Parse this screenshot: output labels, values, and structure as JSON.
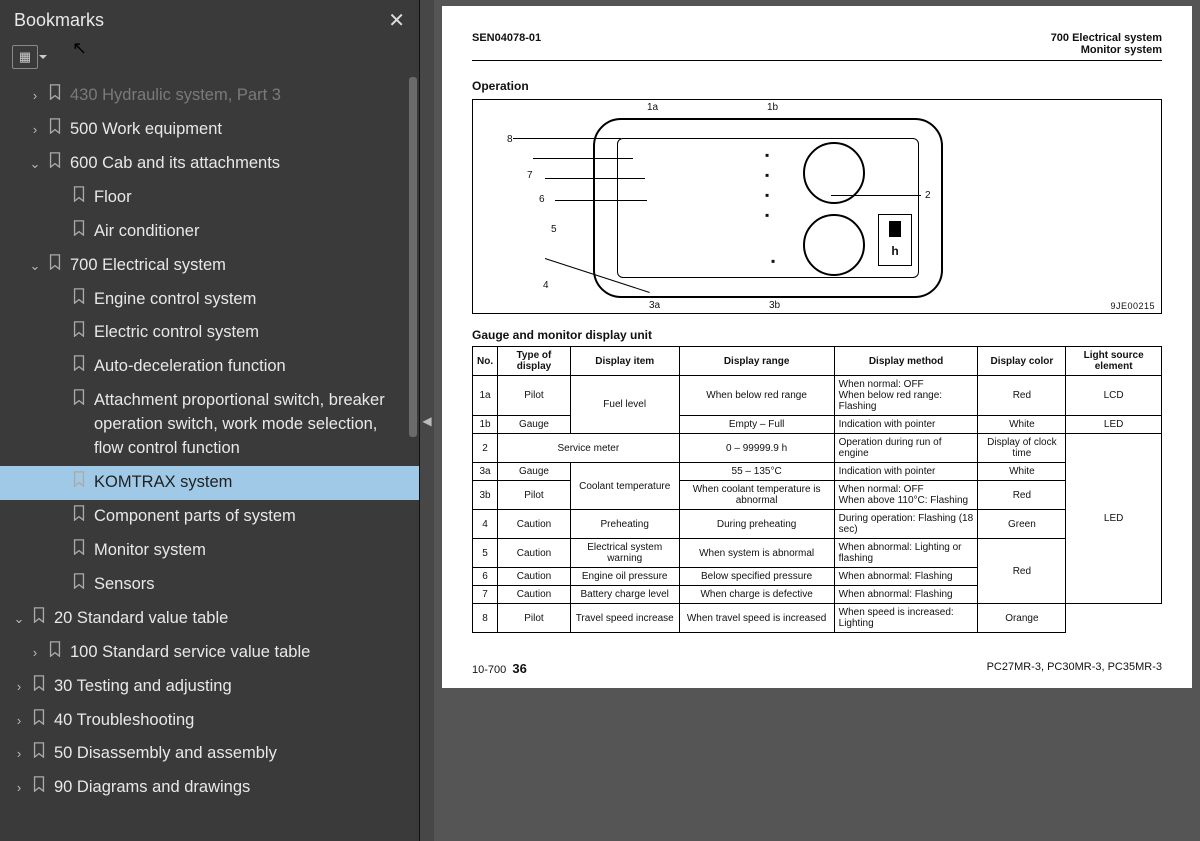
{
  "sidebar": {
    "title": "Bookmarks",
    "items": [
      {
        "indent": 1,
        "arrow": "›",
        "label": "430 Hydraulic system, Part 3",
        "cutoff": true
      },
      {
        "indent": 1,
        "arrow": "›",
        "label": "500 Work equipment"
      },
      {
        "indent": 1,
        "arrow": "⌄",
        "label": "600 Cab and its attachments"
      },
      {
        "indent": 2,
        "arrow": "",
        "label": "Floor"
      },
      {
        "indent": 2,
        "arrow": "",
        "label": "Air conditioner"
      },
      {
        "indent": 1,
        "arrow": "⌄",
        "label": "700 Electrical system"
      },
      {
        "indent": 2,
        "arrow": "",
        "label": "Engine control system"
      },
      {
        "indent": 2,
        "arrow": "",
        "label": "Electric control system"
      },
      {
        "indent": 2,
        "arrow": "",
        "label": "Auto-deceleration function"
      },
      {
        "indent": 2,
        "arrow": "",
        "label": "Attachment proportional switch, breaker operation switch, work mode selection, flow control function"
      },
      {
        "indent": 2,
        "arrow": "",
        "label": "KOMTRAX system",
        "selected": true
      },
      {
        "indent": 2,
        "arrow": "",
        "label": "Component parts of system"
      },
      {
        "indent": 2,
        "arrow": "",
        "label": "Monitor system"
      },
      {
        "indent": 2,
        "arrow": "",
        "label": "Sensors"
      },
      {
        "indent": 0,
        "arrow": "⌄",
        "label": "20 Standard value table"
      },
      {
        "indent": 1,
        "arrow": "›",
        "label": "100 Standard service value table"
      },
      {
        "indent": 0,
        "arrow": "›",
        "label": "30 Testing and adjusting"
      },
      {
        "indent": 0,
        "arrow": "›",
        "label": "40 Troubleshooting"
      },
      {
        "indent": 0,
        "arrow": "›",
        "label": "50 Disassembly and assembly"
      },
      {
        "indent": 0,
        "arrow": "›",
        "label": "90 Diagrams and drawings"
      }
    ]
  },
  "doc": {
    "code": "SEN04078-01",
    "chapter": "700 Electrical system",
    "subchapter": "Monitor system",
    "section": "Operation",
    "diagram_code": "9JE00215",
    "diagram_labels": [
      "1a",
      "1b",
      "2",
      "3a",
      "3b",
      "4",
      "5",
      "6",
      "7",
      "8"
    ],
    "table_title": "Gauge and monitor display unit",
    "headers": [
      "No.",
      "Type of display",
      "Display item",
      "Display range",
      "Display method",
      "Display color",
      "Light source element"
    ],
    "rows": [
      {
        "no": "1a",
        "type": "Pilot",
        "item": "Fuel level",
        "range": "When below red range",
        "method": "When normal: OFF\nWhen below red range: Flashing",
        "color": "Red",
        "src": "LCD",
        "item_rowspan": 2
      },
      {
        "no": "1b",
        "type": "Gauge",
        "item": "",
        "range": "Empty – Full",
        "method": "Indication with pointer",
        "color": "White",
        "src": "LED"
      },
      {
        "no": "2",
        "type": "Service meter",
        "type_colspan": 2,
        "item": "",
        "range": "0 – 99999.9 h",
        "method": "Operation during run of engine",
        "color": "Display of clock time",
        "src": "LED",
        "src_rowspan": 7
      },
      {
        "no": "3a",
        "type": "Gauge",
        "item": "Coolant temperature",
        "range": "55 – 135°C",
        "method": "Indication with pointer",
        "color": "White",
        "item_rowspan": 2
      },
      {
        "no": "3b",
        "type": "Pilot",
        "item": "",
        "range": "When coolant temperature is abnormal",
        "method": "When normal: OFF\nWhen above 110°C: Flashing",
        "color": "Red"
      },
      {
        "no": "4",
        "type": "Caution",
        "item": "Preheating",
        "range": "During preheating",
        "method": "During operation: Flashing (18 sec)",
        "color": "Green"
      },
      {
        "no": "5",
        "type": "Caution",
        "item": "Electrical system warning",
        "range": "When system is abnormal",
        "method": "When abnormal: Lighting or flashing",
        "color": "Red",
        "color_rowspan": 3
      },
      {
        "no": "6",
        "type": "Caution",
        "item": "Engine oil pressure",
        "range": "Below specified pressure",
        "method": "When abnormal: Flashing"
      },
      {
        "no": "7",
        "type": "Caution",
        "item": "Battery charge level",
        "range": "When charge is defective",
        "method": "When abnormal: Flashing"
      },
      {
        "no": "8",
        "type": "Pilot",
        "item": "Travel speed increase",
        "range": "When travel speed is increased",
        "method": "When speed is increased: Lighting",
        "color": "Orange"
      }
    ],
    "footer_left": "10-700",
    "footer_page": "36",
    "footer_right": "PC27MR-3, PC30MR-3, PC35MR-3"
  }
}
